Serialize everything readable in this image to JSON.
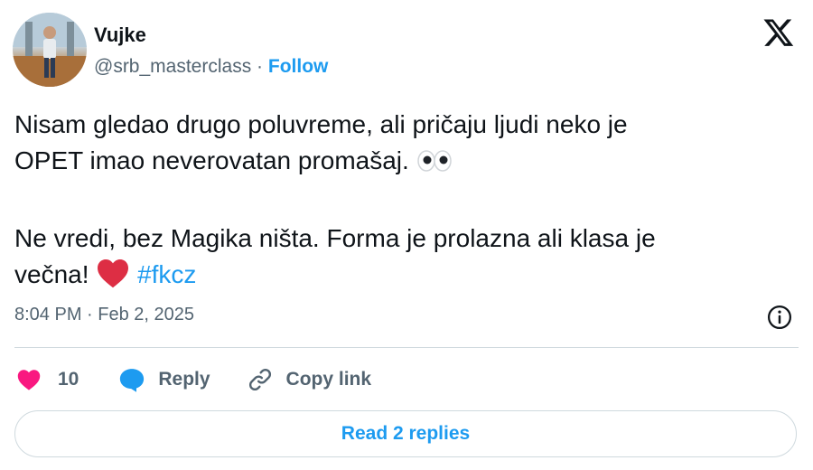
{
  "author": {
    "name": "Vujke",
    "handle": "@srb_masterclass",
    "separator": "·",
    "follow_label": "Follow"
  },
  "tweet": {
    "line1": "Nisam gledao drugo poluvreme, ali pričaju ljudi neko je",
    "line2": "OPET imao neverovatan promašaj.",
    "line3": "Ne vredi, bez Magika ništa. Forma je prolazna ali klasa je",
    "line4": "večna!",
    "hashtag": "#fkcz",
    "emojis": [
      "eyes-emoji",
      "red-heart-emoji"
    ]
  },
  "meta": {
    "timestamp": "8:04 PM · Feb 2, 2025"
  },
  "actions": {
    "like_count": "10",
    "reply_label": "Reply",
    "copy_label": "Copy link"
  },
  "footer": {
    "read_replies_label": "Read 2 replies"
  },
  "colors": {
    "accent": "#1d9bf0",
    "like": "#f91880",
    "muted": "#536471",
    "text": "#0f1419",
    "border": "#cfd9de"
  }
}
